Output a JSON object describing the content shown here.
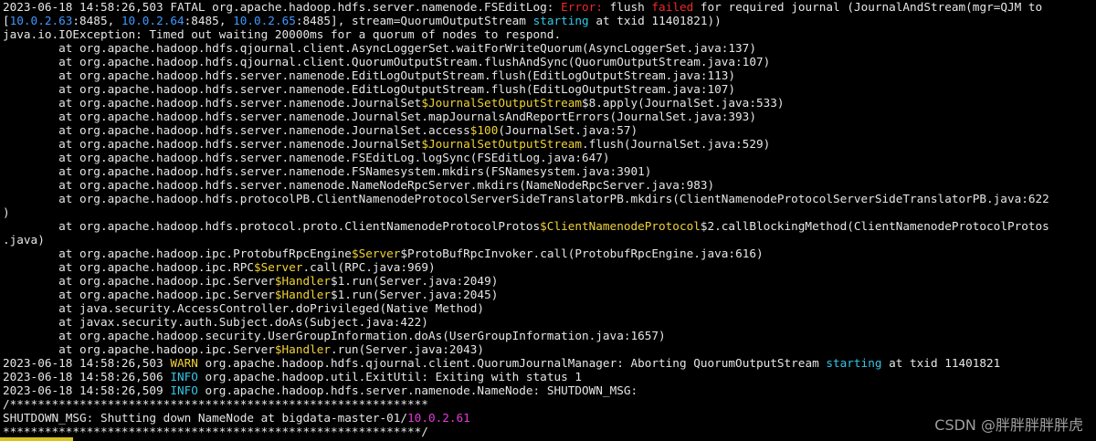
{
  "terminal": {
    "background": "#000000",
    "colors": {
      "default": "#e6e6e6",
      "error": "#ef2929",
      "ip": "#3f98ff",
      "keyword": "#e33bd6",
      "starting": "#34c6e6",
      "inner_class": "#f0d236"
    },
    "lines": [
      [
        {
          "t": "2023-06-18 14:58:26,503 FATAL org.apache.hadoop.hdfs.server.namenode.FSEditLog: "
        },
        {
          "t": "Error:",
          "c": "red"
        },
        {
          "t": " flush "
        },
        {
          "t": "failed",
          "c": "red"
        },
        {
          "t": " for required journal (JournalAndStream(mgr=QJM to"
        }
      ],
      [
        {
          "t": "["
        },
        {
          "t": "10.0.2.63",
          "c": "blue"
        },
        {
          "t": ":8485, "
        },
        {
          "t": "10.0.2.64",
          "c": "blue"
        },
        {
          "t": ":8485, "
        },
        {
          "t": "10.0.2.65",
          "c": "blue"
        },
        {
          "t": ":8485], stream=QuorumOutputStream "
        },
        {
          "t": "starting",
          "c": "cyan"
        },
        {
          "t": " at txid 11401821))"
        }
      ],
      [
        {
          "t": "java.io.IOException: Timed out waiting 20000ms for a quorum of nodes to respond."
        }
      ],
      [
        {
          "t": "        at org.apache.hadoop.hdfs.qjournal.client.AsyncLoggerSet.waitForWriteQuorum(AsyncLoggerSet.java:137)"
        }
      ],
      [
        {
          "t": "        at org.apache.hadoop.hdfs.qjournal.client.QuorumOutputStream.flushAndSync(QuorumOutputStream.java:107)"
        }
      ],
      [
        {
          "t": "        at org.apache.hadoop.hdfs.server.namenode.EditLogOutputStream.flush(EditLogOutputStream.java:113)"
        }
      ],
      [
        {
          "t": "        at org.apache.hadoop.hdfs.server.namenode.EditLogOutputStream.flush(EditLogOutputStream.java:107)"
        }
      ],
      [
        {
          "t": "        at org.apache.hadoop.hdfs.server.namenode.JournalSet"
        },
        {
          "t": "$JournalSetOutputStream",
          "c": "yellow"
        },
        {
          "t": "$8.apply(JournalSet.java:533)"
        }
      ],
      [
        {
          "t": "        at org.apache.hadoop.hdfs.server.namenode.JournalSet.mapJournalsAndReportErrors(JournalSet.java:393)"
        }
      ],
      [
        {
          "t": "        at org.apache.hadoop.hdfs.server.namenode.JournalSet.access"
        },
        {
          "t": "$100",
          "c": "yellow"
        },
        {
          "t": "(JournalSet.java:57)"
        }
      ],
      [
        {
          "t": "        at org.apache.hadoop.hdfs.server.namenode.JournalSet"
        },
        {
          "t": "$JournalSetOutputStream",
          "c": "yellow"
        },
        {
          "t": ".flush(JournalSet.java:529)"
        }
      ],
      [
        {
          "t": "        at org.apache.hadoop.hdfs.server.namenode.FSEditLog.logSync(FSEditLog.java:647)"
        }
      ],
      [
        {
          "t": "        at org.apache.hadoop.hdfs.server.namenode.FSNamesystem.mkdirs(FSNamesystem.java:3901)"
        }
      ],
      [
        {
          "t": "        at org.apache.hadoop.hdfs.server.namenode.NameNodeRpcServer.mkdirs(NameNodeRpcServer.java:983)"
        }
      ],
      [
        {
          "t": "        at org.apache.hadoop.hdfs.protocolPB.ClientNamenodeProtocolServerSideTranslatorPB.mkdirs(ClientNamenodeProtocolServerSideTranslatorPB.java:622"
        }
      ],
      [
        {
          "t": ")"
        }
      ],
      [
        {
          "t": "        at org.apache.hadoop.hdfs.protocol.proto.ClientNamenodeProtocolProtos"
        },
        {
          "t": "$ClientNamenodeProtocol",
          "c": "yellow"
        },
        {
          "t": "$2.callBlockingMethod(ClientNamenodeProtocolProtos"
        }
      ],
      [
        {
          "t": ".java)"
        }
      ],
      [
        {
          "t": "        at org.apache.hadoop.ipc.ProtobufRpcEngine"
        },
        {
          "t": "$Server",
          "c": "yellow"
        },
        {
          "t": "$ProtoBufRpcInvoker.call(ProtobufRpcEngine.java:616)"
        }
      ],
      [
        {
          "t": "        at org.apache.hadoop.ipc.RPC"
        },
        {
          "t": "$Server",
          "c": "yellow"
        },
        {
          "t": ".call(RPC.java:969)"
        }
      ],
      [
        {
          "t": "        at org.apache.hadoop.ipc.Server"
        },
        {
          "t": "$Handler",
          "c": "yellow"
        },
        {
          "t": "$1.run(Server.java:2049)"
        }
      ],
      [
        {
          "t": "        at org.apache.hadoop.ipc.Server"
        },
        {
          "t": "$Handler",
          "c": "yellow"
        },
        {
          "t": "$1.run(Server.java:2045)"
        }
      ],
      [
        {
          "t": "        at java.security.AccessController.doPrivileged(Native Method)"
        }
      ],
      [
        {
          "t": "        at javax.security.auth.Subject.doAs(Subject.java:422)"
        }
      ],
      [
        {
          "t": "        at org.apache.hadoop.security.UserGroupInformation.doAs(UserGroupInformation.java:1657)"
        }
      ],
      [
        {
          "t": "        at org.apache.hadoop.ipc.Server"
        },
        {
          "t": "$Handler",
          "c": "yellow"
        },
        {
          "t": ".run(Server.java:2043)"
        }
      ],
      [
        {
          "t": "2023-06-18 14:58:26,503 "
        },
        {
          "t": "WARN",
          "c": "yellow"
        },
        {
          "t": " org.apache.hadoop.hdfs.qjournal.client.QuorumJournalManager: Aborting QuorumOutputStream "
        },
        {
          "t": "starting",
          "c": "cyan"
        },
        {
          "t": " at txid 11401821"
        }
      ],
      [
        {
          "t": "2023-06-18 14:58:26,506 "
        },
        {
          "t": "INFO",
          "c": "cyan"
        },
        {
          "t": " org.apache.hadoop.util.ExitUtil: Exiting with status 1"
        }
      ],
      [
        {
          "t": "2023-06-18 14:58:26,509 "
        },
        {
          "t": "INFO",
          "c": "cyan"
        },
        {
          "t": " org.apache.hadoop.hdfs.server.namenode.NameNode: SHUTDOWN_MSG:"
        }
      ],
      [
        {
          "t": "/************************************************************"
        }
      ],
      [
        {
          "t": "SHUTDOWN_MSG: Shutting down NameNode at bigdata-master-01/"
        },
        {
          "t": "10.0.2.61",
          "c": "magenta"
        }
      ],
      [
        {
          "t": "************************************************************/"
        }
      ]
    ]
  },
  "watermark": {
    "text": "CSDN @胖胖胖胖胖虎"
  }
}
